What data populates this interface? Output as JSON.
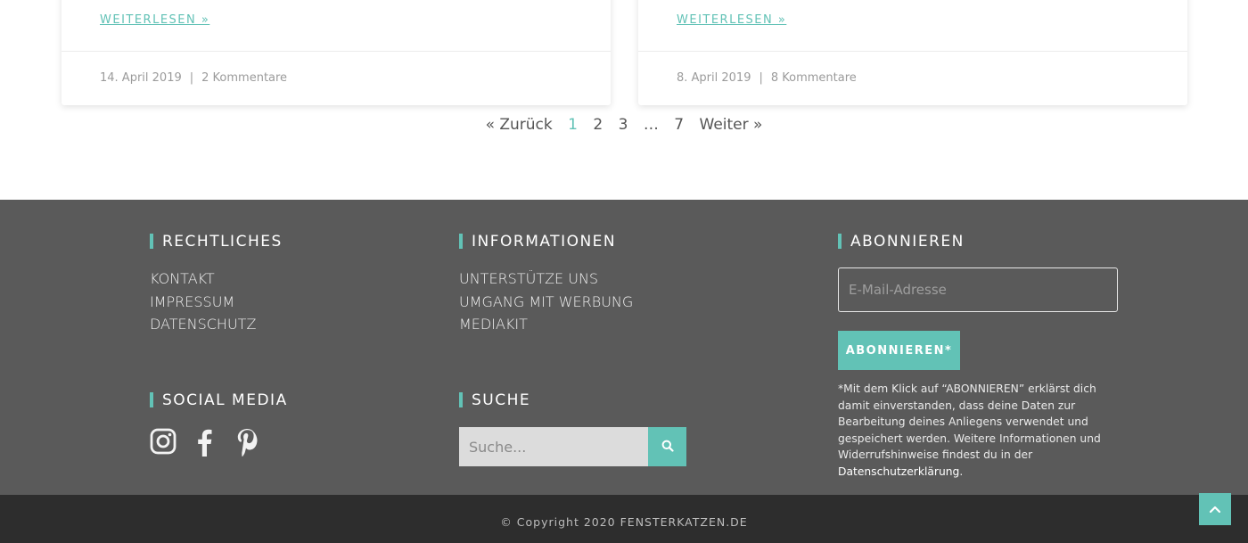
{
  "cards": [
    {
      "readmore": "WEITERLESEN »",
      "date": "14. April 2019",
      "separator": "|",
      "comments": "2 Kommentare"
    },
    {
      "readmore": "WEITERLESEN »",
      "date": "8. April 2019",
      "separator": "|",
      "comments": "8 Kommentare"
    }
  ],
  "pagination": {
    "prev": "« Zurück",
    "pages": [
      "1",
      "2",
      "3",
      "…",
      "7"
    ],
    "current": "1",
    "next": "Weiter »"
  },
  "footer": {
    "legal": {
      "heading": "RECHTLICHES",
      "links": [
        "KONTAKT",
        "IMPRESSUM",
        "DATENSCHUTZ"
      ]
    },
    "info": {
      "heading": "INFORMATIONEN",
      "links": [
        "UNTERSTÜTZE UNS",
        "UMGANG MIT WERBUNG",
        "MEDIAKIT"
      ]
    },
    "subscribe": {
      "heading": "ABONNIEREN",
      "email_placeholder": "E-Mail-Adresse",
      "button": "ABONNIEREN*",
      "notice_text": "*Mit dem Klick auf “ABONNIEREN” erklärst dich damit einverstanden, dass deine Daten zur Bearbeitung deines Anliegens verwendet und gespeichert werden. Weitere Informationen und Widerrufshinweise findest du in der ",
      "notice_link": "Datenschutzerklärung",
      "notice_end": "."
    },
    "social": {
      "heading": "SOCIAL MEDIA",
      "icons": [
        "instagram-icon",
        "facebook-icon",
        "pinterest-icon"
      ]
    },
    "search": {
      "heading": "SUCHE",
      "placeholder": "Suche..."
    }
  },
  "copyright": "© Copyright 2020 FENSTERKATZEN.DE",
  "colors": {
    "accent": "#62c2b6",
    "footer_bg": "#5a5a5a",
    "bottom_bg": "#2d2d2d"
  }
}
